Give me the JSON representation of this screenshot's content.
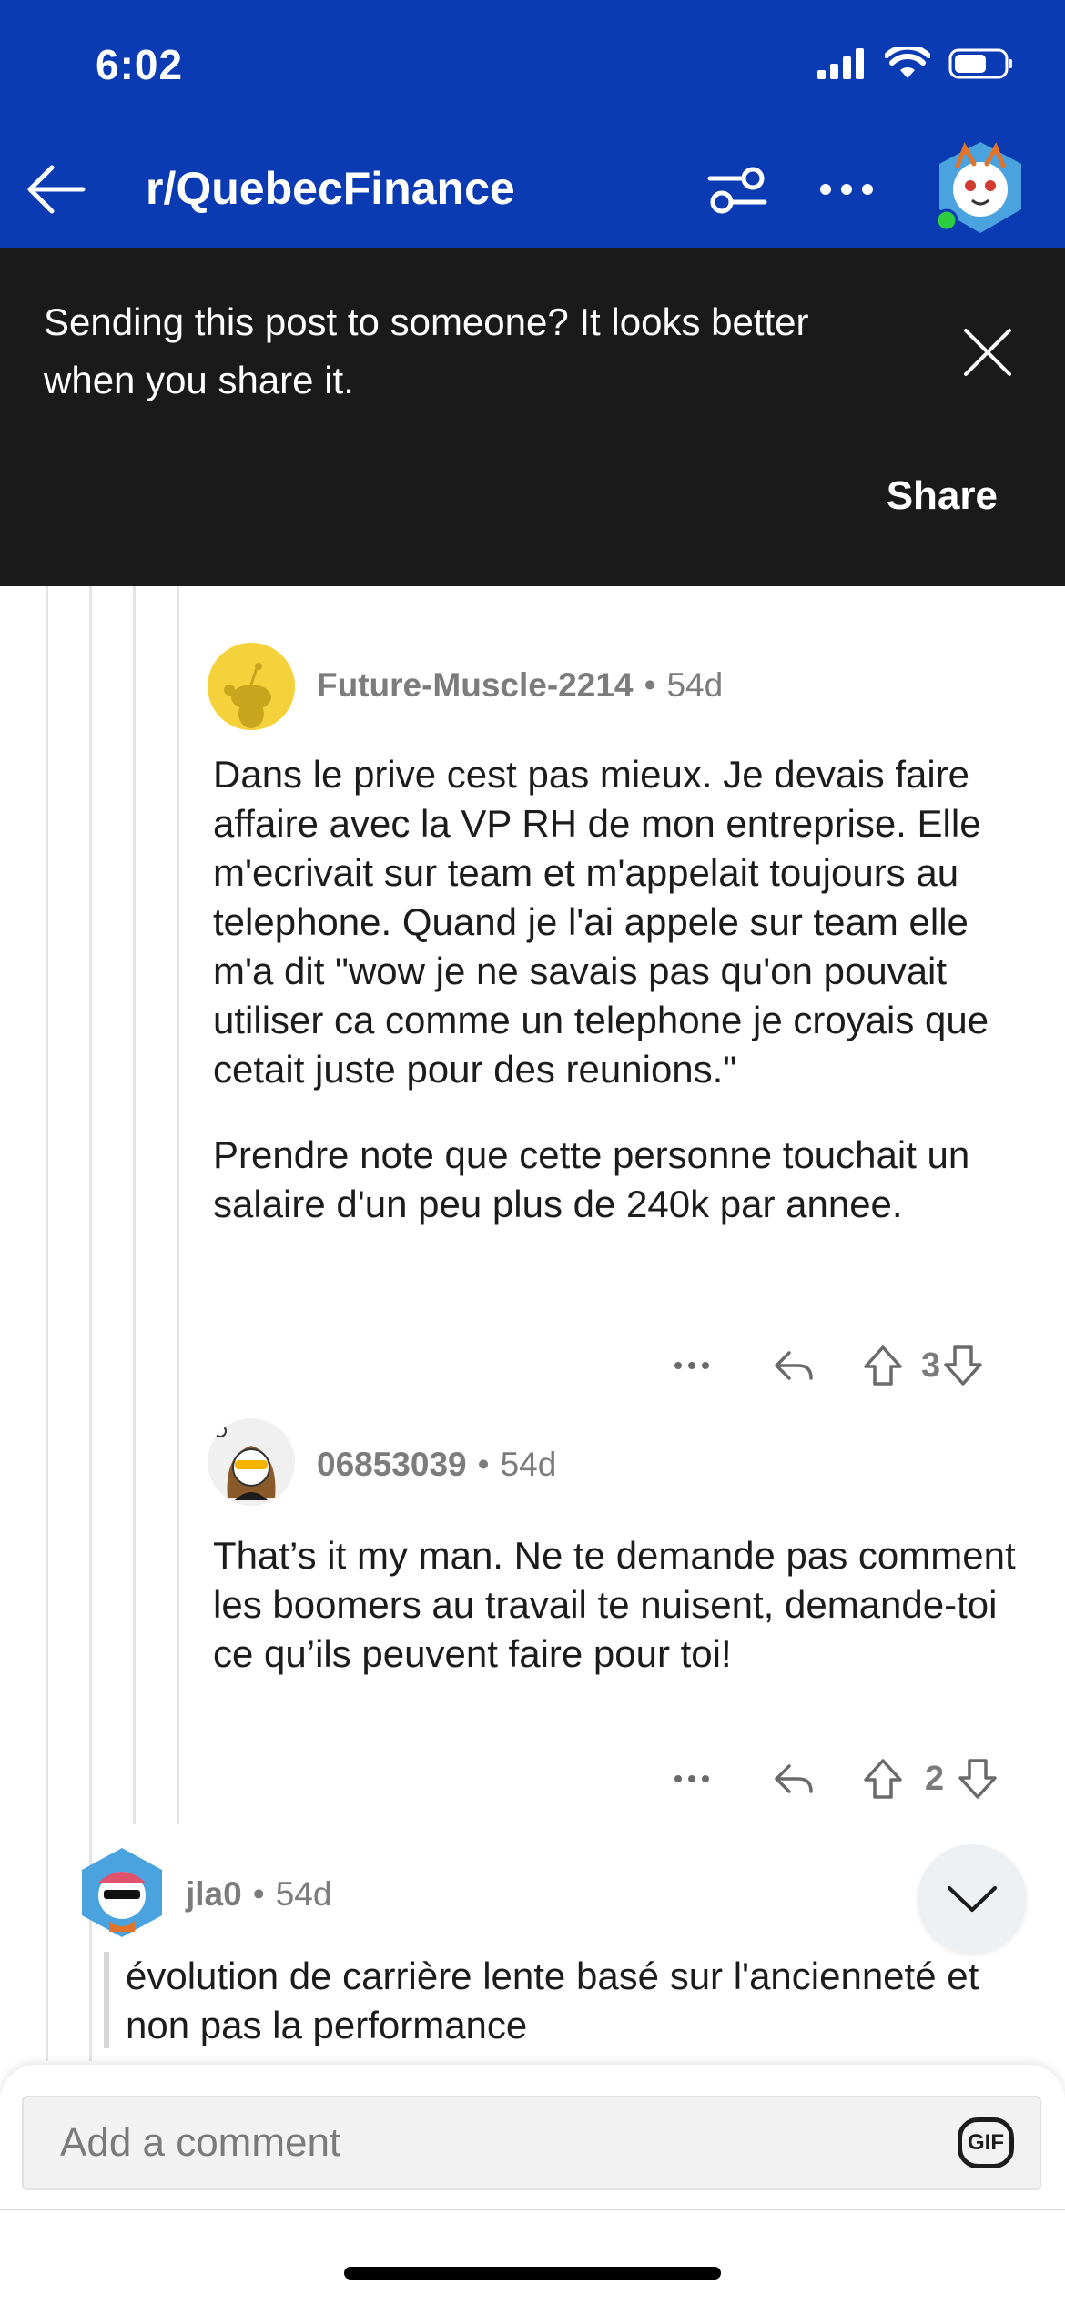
{
  "status_bar": {
    "time": "6:02"
  },
  "header": {
    "title": "r/QuebecFinance"
  },
  "share_banner": {
    "message": "Sending this post to someone? It looks better when you share it.",
    "share_label": "Share"
  },
  "comments": [
    {
      "author": "Future-Muscle-2214",
      "age": "54d",
      "paragraphs": [
        "Dans le prive cest pas mieux. Je devais faire affaire avec la VP RH de mon entreprise. Elle m'ecrivait sur team et m'appelait toujours au telephone. Quand je l'ai appele sur team elle m'a dit \"wow je ne savais pas qu'on pouvait utiliser ca comme un telephone je croyais que cetait juste pour des reunions.\"",
        "Prendre note que cette personne touchait un salaire d'un peu plus de 240k par annee."
      ],
      "score": "3"
    },
    {
      "author": "06853039",
      "age": "54d",
      "paragraphs": [
        "That’s it my man. Ne te demande pas comment les boomers au travail te nuisent, demande-toi ce qu’ils peuvent faire pour toi!"
      ],
      "score": "2"
    },
    {
      "author": "jla0",
      "age": "54d",
      "quote": "évolution de carrière lente basé sur l'ancienneté et non pas la performance"
    }
  ],
  "composer": {
    "placeholder": "Add a comment",
    "gif_label": "GIF"
  },
  "colors": {
    "header_bg": "#0b3bb3",
    "banner_bg": "#1a1a1b",
    "meta_text": "#7c7c7c"
  }
}
